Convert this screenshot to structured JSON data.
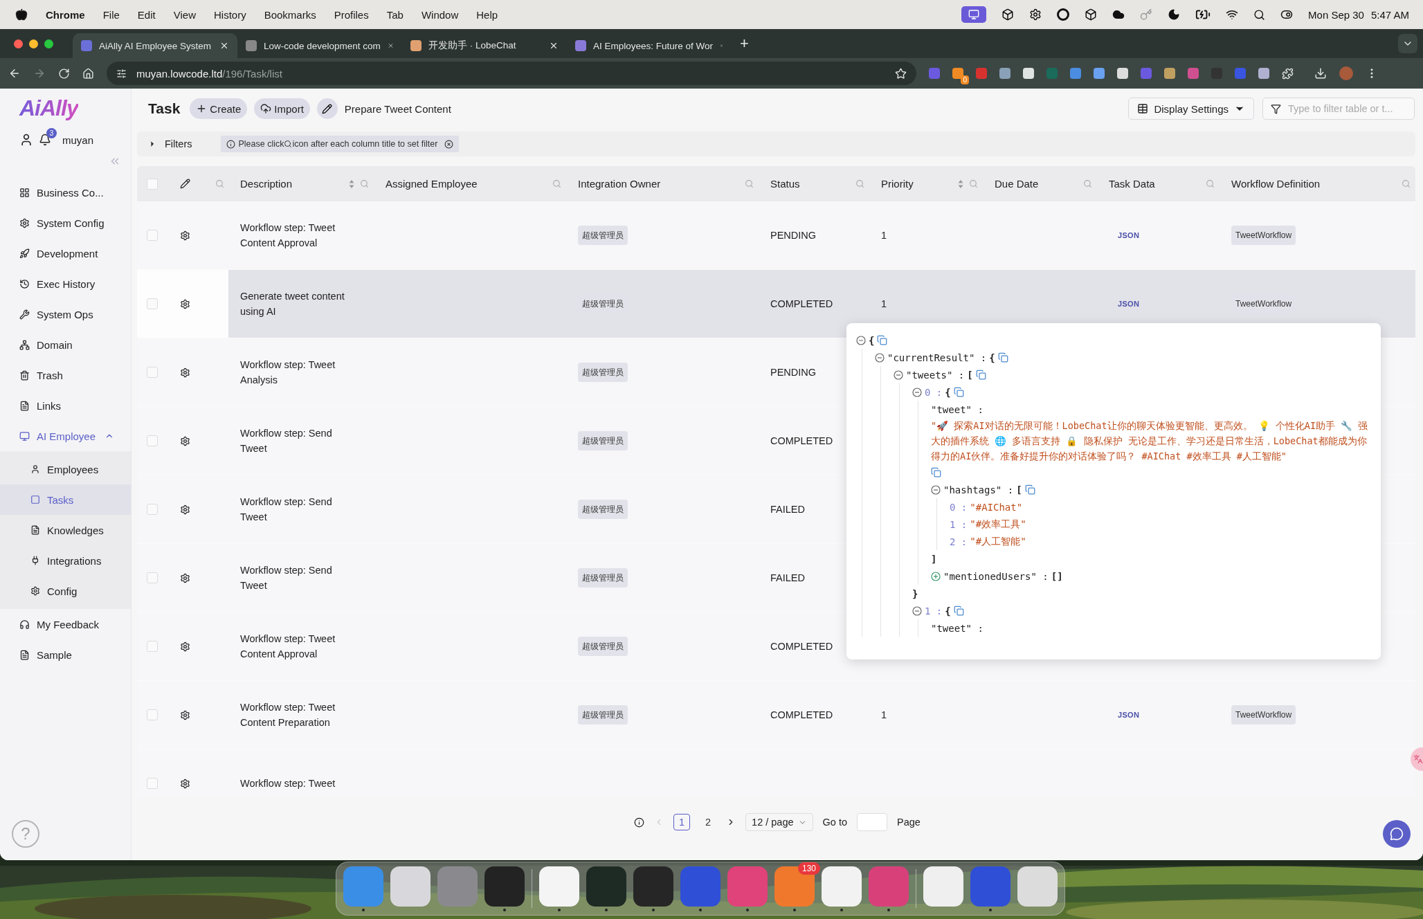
{
  "menubar": {
    "menus": [
      {
        "label": "Chrome",
        "bold": true
      },
      {
        "label": "File",
        "bold": false
      },
      {
        "label": "Edit",
        "bold": false
      },
      {
        "label": "View",
        "bold": false
      },
      {
        "label": "History",
        "bold": false
      },
      {
        "label": "Bookmarks",
        "bold": false
      },
      {
        "label": "Profiles",
        "bold": false
      },
      {
        "label": "Tab",
        "bold": false
      },
      {
        "label": "Window",
        "bold": false
      },
      {
        "label": "Help",
        "bold": false
      }
    ],
    "date": "Mon Sep 30",
    "time": "5:47 AM"
  },
  "browser": {
    "tabs": [
      {
        "title": "AiAlly AI Employee System",
        "selected": true
      },
      {
        "title": "Low-code development com",
        "selected": false
      },
      {
        "title": "开发助手 · LobeChat",
        "selected": false
      },
      {
        "title": "AI Employees: Future of Wor",
        "selected": false
      }
    ],
    "new_tab": "+",
    "url_host": "muyan.lowcode.ltd",
    "url_path": "/196/Task/list",
    "extension_badge": "0"
  },
  "sidebar": {
    "logo": "AiAlly",
    "user": "muyan",
    "notifications": "3",
    "items": [
      {
        "label": "Business Co..."
      },
      {
        "label": "System Config"
      },
      {
        "label": "Development"
      },
      {
        "label": "Exec History"
      },
      {
        "label": "System Ops"
      },
      {
        "label": "Domain"
      },
      {
        "label": "Trash"
      },
      {
        "label": "Links"
      },
      {
        "label": "AI Employee",
        "expanded": true,
        "children": [
          {
            "label": "Employees",
            "selected": false
          },
          {
            "label": "Tasks",
            "selected": true
          },
          {
            "label": "Knowledges",
            "selected": false
          },
          {
            "label": "Integrations",
            "selected": false
          },
          {
            "label": "Config",
            "selected": false
          }
        ]
      },
      {
        "label": "My Feedback"
      },
      {
        "label": "Sample"
      }
    ],
    "help": "?"
  },
  "header": {
    "title": "Task",
    "buttons": [
      {
        "label": "Create"
      },
      {
        "label": "Import"
      }
    ],
    "action": "Prepare Tweet Content",
    "display_settings": "Display Settings",
    "filter_placeholder": "Type to filter table or t..."
  },
  "filters": {
    "label": "Filters",
    "expanded": false,
    "hint_before": "Please click",
    "hint_after": "icon after each column title to set filter"
  },
  "table": {
    "select_all_checked": false,
    "columns": [
      {
        "label": "Description",
        "sortable": true
      },
      {
        "label": "Assigned Employee",
        "sortable": false
      },
      {
        "label": "Integration Owner",
        "sortable": false
      },
      {
        "label": "Status",
        "sortable": false
      },
      {
        "label": "Priority",
        "sortable": true
      },
      {
        "label": "Due Date",
        "sortable": false
      },
      {
        "label": "Task Data",
        "sortable": false
      },
      {
        "label": "Workflow Definition",
        "sortable": false
      }
    ],
    "rows": [
      {
        "description": "Workflow step: Tweet Content Approval",
        "owner": "超级管理员",
        "status": "PENDING",
        "priority": "1",
        "task_data": "JSON",
        "workflow": "TweetWorkflow",
        "highlighted": false
      },
      {
        "description": "Generate tweet content using AI",
        "owner": "超级管理员",
        "status": "COMPLETED",
        "priority": "1",
        "task_data": "JSON",
        "workflow": "TweetWorkflow",
        "highlighted": true
      },
      {
        "description": "Workflow step: Tweet Analysis",
        "owner": "超级管理员",
        "status": "PENDING",
        "highlighted": false
      },
      {
        "description": "Workflow step: Send Tweet",
        "owner": "超级管理员",
        "status": "COMPLETED",
        "highlighted": false
      },
      {
        "description": "Workflow step: Send Tweet",
        "owner": "超级管理员",
        "status": "FAILED",
        "highlighted": false
      },
      {
        "description": "Workflow step: Send Tweet",
        "owner": "超级管理员",
        "status": "FAILED",
        "highlighted": false
      },
      {
        "description": "Workflow step: Tweet Content Approval",
        "owner": "超级管理员",
        "status": "COMPLETED",
        "highlighted": false
      },
      {
        "description": "Workflow step: Tweet Content Preparation",
        "owner": "超级管理员",
        "status": "COMPLETED",
        "priority": "1",
        "task_data": "JSON",
        "workflow": "TweetWorkflow",
        "highlighted": false
      },
      {
        "description": "Workflow step: Tweet",
        "highlighted": false
      }
    ]
  },
  "json_viewer": {
    "root": {
      "open": "{",
      "expanded": true,
      "children": [
        {
          "key": "\"currentResult\" :",
          "kind": "name",
          "open": "{",
          "expanded": true,
          "children": [
            {
              "key": "\"tweets\" :",
              "kind": "name",
              "open": "[",
              "expanded": true,
              "children": [
                {
                  "key": "0 :",
                  "kind": "index",
                  "open": "{",
                  "expanded": true,
                  "close": "}",
                  "children": [
                    {
                      "key": "\"tweet\" :",
                      "kind": "name",
                      "value": "\"🚀 探索AI对话的无限可能！LobeChat让你的聊天体验更智能、更高效。 💡 个性化AI助手 🔧 强大的插件系统 🌐 多语言支持 🔒 隐私保护 无论是工作、学习还是日常生活，LobeChat都能成为你得力的AI伙伴。准备好提升你的对话体验了吗？ #AIChat #效率工具 #人工智能\""
                    },
                    {
                      "key": "\"hashtags\" :",
                      "kind": "name",
                      "open": "[",
                      "expanded": true,
                      "close": "]",
                      "children": [
                        {
                          "key": "0 :",
                          "kind": "index",
                          "value": "\"#AIChat\""
                        },
                        {
                          "key": "1 :",
                          "kind": "index",
                          "value": "\"#效率工具\""
                        },
                        {
                          "key": "2 :",
                          "kind": "index",
                          "value": "\"#人工智能\""
                        }
                      ]
                    },
                    {
                      "key": "\"mentionedUsers\" :",
                      "kind": "name",
                      "open": "[]",
                      "expanded": false
                    }
                  ]
                },
                {
                  "key": "1 :",
                  "kind": "index",
                  "open": "{",
                  "expanded": true,
                  "children": [
                    {
                      "key": "\"tweet\" :",
                      "kind": "name"
                    }
                  ]
                }
              ]
            }
          ]
        }
      ]
    }
  },
  "pagination": {
    "pages": [
      {
        "label": "1",
        "selected": true
      },
      {
        "label": "2",
        "selected": false
      }
    ],
    "prev_disabled": true,
    "page_size": "12 / page",
    "goto": "Go to",
    "page": "Page"
  },
  "dock": {
    "groups": [
      [
        {
          "color": "#3a8ee6",
          "running": true
        },
        {
          "color": "#d8d8dc",
          "running": false
        },
        {
          "color": "#8a8a8e",
          "running": false
        },
        {
          "color": "#232323",
          "running": true
        }
      ],
      [
        {
          "color": "#f4f4f4",
          "running": true
        },
        {
          "color": "#1e2a24",
          "running": true
        },
        {
          "color": "#262626",
          "running": true
        },
        {
          "color": "#2f4fd6",
          "running": true
        },
        {
          "color": "#e0427a",
          "running": true
        },
        {
          "color": "#f0782c",
          "running": true,
          "badge": "130"
        },
        {
          "color": "#f2f2f2",
          "running": true
        },
        {
          "color": "#d8407a",
          "running": true
        }
      ],
      [
        {
          "color": "#efefef",
          "running": false
        },
        {
          "color": "#2f4fd6",
          "running": true
        },
        {
          "color": "#dcdcdc",
          "running": false
        }
      ]
    ]
  }
}
